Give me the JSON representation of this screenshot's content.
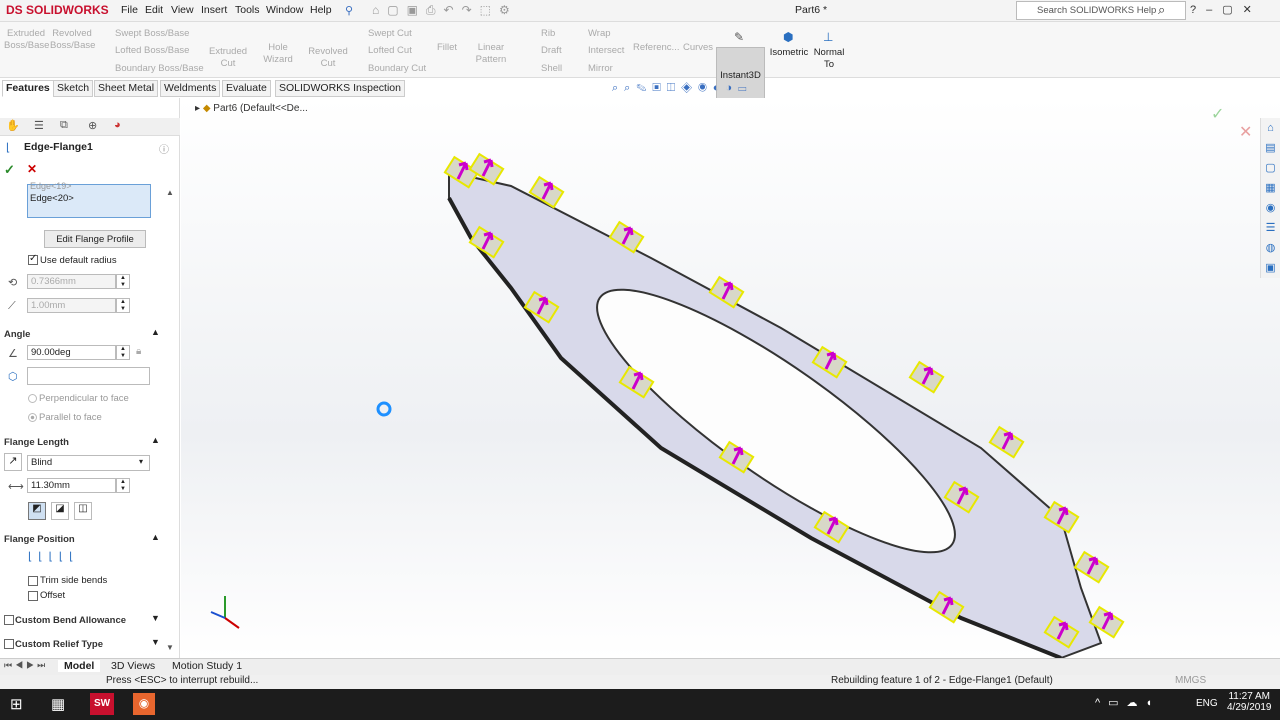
{
  "app": {
    "logo": "DS SOLIDWORKS",
    "doc_title": "Part6 *",
    "search_placeholder": "Search SOLIDWORKS Help"
  },
  "menu": [
    "File",
    "Edit",
    "View",
    "Insert",
    "Tools",
    "Window",
    "Help"
  ],
  "ribbon": {
    "extruded_boss": "Extruded Boss/Base",
    "revolved_boss": "Revolved Boss/Base",
    "swept_boss": "Swept Boss/Base",
    "lofted_boss": "Lofted Boss/Base",
    "boundary_boss": "Boundary Boss/Base",
    "extruded_cut": "Extruded Cut",
    "hole_wizard": "Hole Wizard",
    "revolved_cut": "Revolved Cut",
    "swept_cut": "Swept Cut",
    "lofted_cut": "Lofted Cut",
    "boundary_cut": "Boundary Cut",
    "fillet": "Fillet",
    "linear_pattern": "Linear Pattern",
    "rib": "Rib",
    "draft": "Draft",
    "shell": "Shell",
    "wrap": "Wrap",
    "intersect": "Intersect",
    "mirror": "Mirror",
    "reference": "Referenc...",
    "curves": "Curves",
    "instant3d": "Instant3D",
    "isometric": "Isometric",
    "normal_to": "Normal To"
  },
  "cm_tabs": [
    "Features",
    "Sketch",
    "Sheet Metal",
    "Weldments",
    "Evaluate",
    "SOLIDWORKS Inspection"
  ],
  "tree_root": "Part6  (Default<<De...",
  "panel": {
    "title": "Edge-Flange1",
    "edges": [
      "Edge<19>",
      "Edge<20>"
    ],
    "edit_profile": "Edit Flange Profile",
    "use_default_radius": "Use default radius",
    "radius": "0.7366mm",
    "thickness": "1.00mm",
    "angle_head": "Angle",
    "angle": "90.00deg",
    "perpendicular": "Perpendicular to face",
    "parallel": "Parallel to face",
    "length_head": "Flange Length",
    "end_condition": "Blind",
    "length": "11.30mm",
    "position_head": "Flange Position",
    "trim": "Trim side bends",
    "offset": "Offset",
    "bend_allowance": "Custom Bend Allowance",
    "relief_type": "Custom Relief Type"
  },
  "bottom_tabs": [
    "Model",
    "3D Views",
    "Motion Study 1"
  ],
  "status": {
    "left": "Press <ESC> to interrupt rebuild...",
    "right": "Rebuilding feature 1 of 2 - Edge-Flange1 (Default)",
    "units": "MMGS"
  },
  "taskbar": {
    "lang": "ENG",
    "time": "11:27 AM",
    "date": "4/29/2019"
  },
  "colors": {
    "accent": "#c8102e",
    "part_face": "#d8d9ea",
    "flange_highlight": "#e8e800",
    "arrow": "#cc00cc"
  }
}
